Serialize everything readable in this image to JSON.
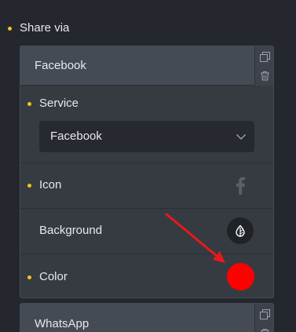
{
  "section_label": "Share via",
  "items": [
    {
      "title": "Facebook"
    },
    {
      "title": "WhatsApp"
    }
  ],
  "fields": {
    "service_label": "Service",
    "service_value": "Facebook",
    "icon_label": "Icon",
    "icon_name": "facebook-icon",
    "background_label": "Background",
    "color_label": "Color"
  },
  "colors": {
    "color_swatch": "#ff0000",
    "accent_dot": "#f5c518",
    "annotation_arrow": "#e8191b"
  }
}
